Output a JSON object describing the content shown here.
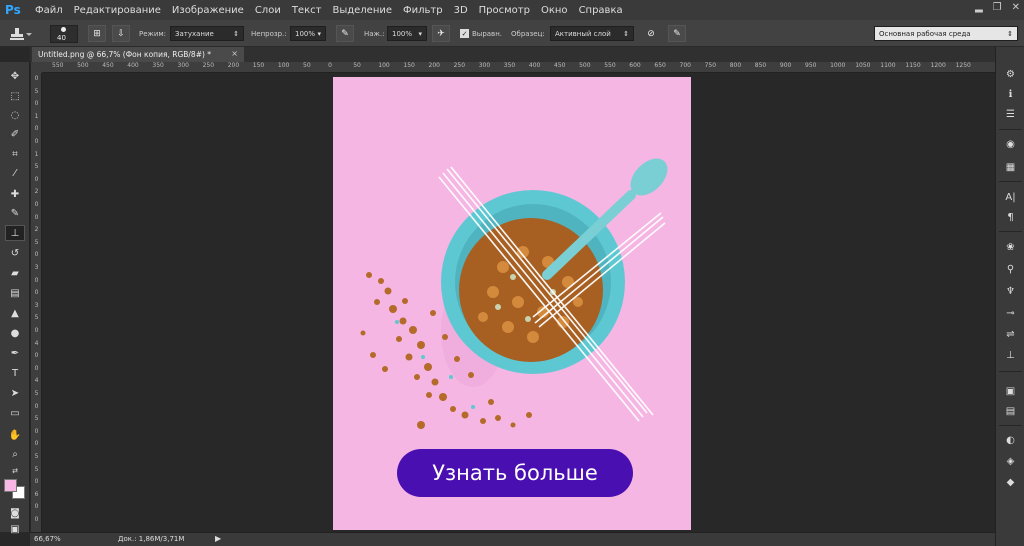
{
  "app": {
    "logo": "Ps",
    "name": "Adobe Photoshop"
  },
  "menu": [
    "Файл",
    "Редактирование",
    "Изображение",
    "Слои",
    "Текст",
    "Выделение",
    "Фильтр",
    "3D",
    "Просмотр",
    "Окно",
    "Справка"
  ],
  "window_controls": {
    "minimize": "▂",
    "restore": "❐",
    "close": "✕"
  },
  "options_bar": {
    "brush_size": "40",
    "mode_label": "Режим:",
    "mode_value": "Затухание",
    "opacity_label": "Непрозр.:",
    "opacity_value": "100%",
    "pressure_label": "Наж.:",
    "pressure_value": "100%",
    "aligned_label": "Выравн.",
    "sample_label": "Образец:",
    "sample_value": "Активный слой",
    "workspace_value": "Основная рабочая среда"
  },
  "document_tab": {
    "title": "Untitled.png @ 66,7% (Фон копия, RGB/8#) *",
    "close": "×"
  },
  "ruler_h": [
    "550",
    "500",
    "450",
    "400",
    "350",
    "300",
    "250",
    "200",
    "150",
    "100",
    "50",
    "0",
    "50",
    "100",
    "150",
    "200",
    "250",
    "300",
    "350",
    "400",
    "450",
    "500",
    "550",
    "600",
    "650",
    "700",
    "750",
    "800",
    "850",
    "900",
    "950",
    "1000",
    "1050",
    "1100",
    "1150",
    "1200",
    "1250"
  ],
  "ruler_v": [
    "0",
    "5",
    "0",
    "1",
    "0",
    "0",
    "1",
    "5",
    "0",
    "2",
    "0",
    "0",
    "2",
    "5",
    "0",
    "3",
    "0",
    "0",
    "3",
    "5",
    "0",
    "4",
    "0",
    "0",
    "4",
    "5",
    "0",
    "5",
    "0",
    "0",
    "5",
    "5",
    "0",
    "6",
    "0",
    "0"
  ],
  "canvas": {
    "background": "#f5b6e4",
    "cta_label": "Узнать больше",
    "cta_color": "#4a0fb0",
    "bowl_color": "#5ec8d2",
    "food_color": "#b46a28"
  },
  "status": {
    "zoom": "66,67%",
    "doc": "Док.: 1,86M/3,71M",
    "arrow": "▶"
  },
  "colors": {
    "foreground": "#f7b8e6",
    "background": "#ffffff"
  }
}
